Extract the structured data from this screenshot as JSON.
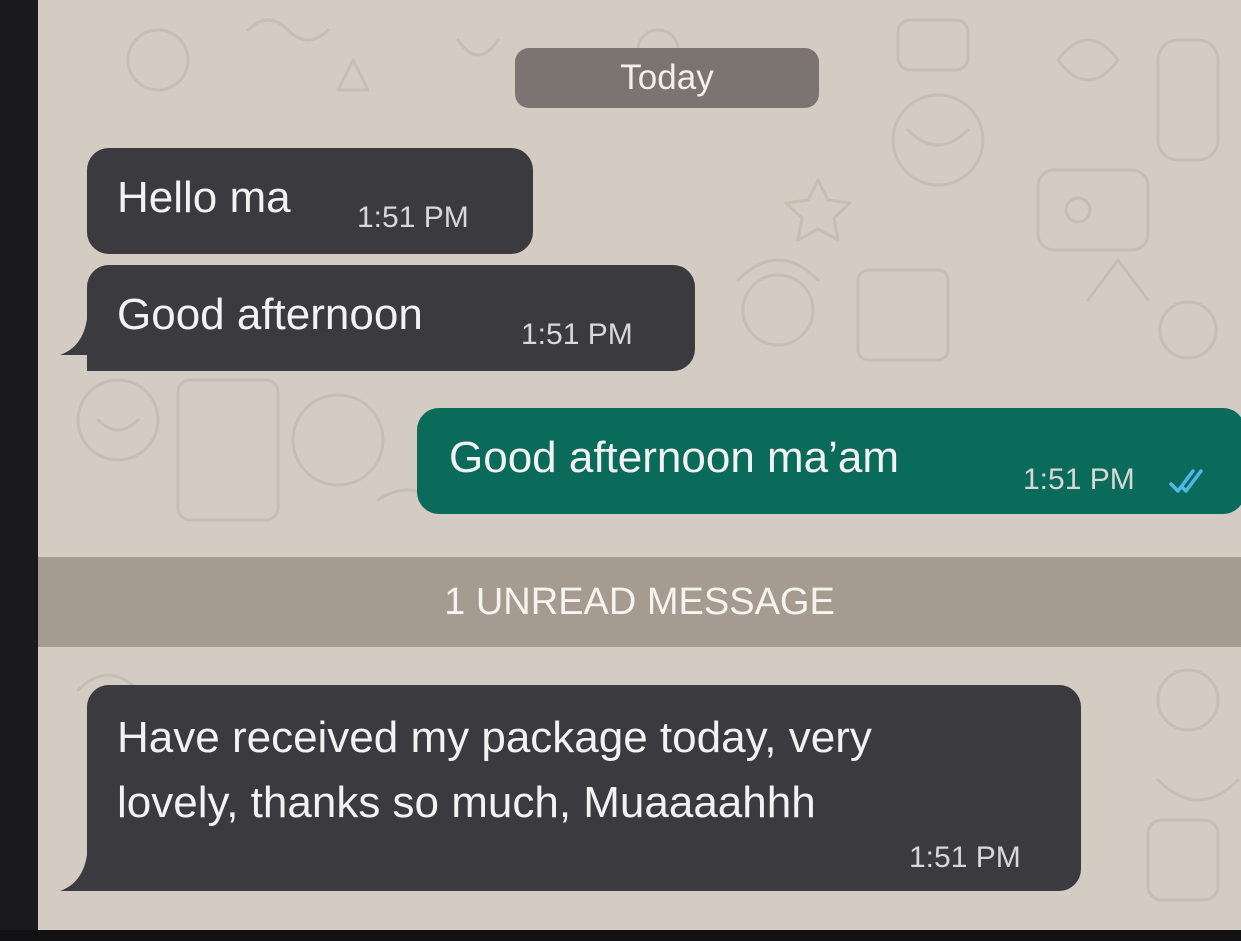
{
  "chat": {
    "date_separator": "Today",
    "unread_banner": "1 UNREAD MESSAGE",
    "messages": [
      {
        "direction": "incoming",
        "text": "Hello ma",
        "time": "1:51 PM"
      },
      {
        "direction": "incoming",
        "text": "Good afternoon",
        "time": "1:51 PM"
      },
      {
        "direction": "outgoing",
        "text": "Good afternoon ma’am",
        "time": "1:51 PM",
        "status": "read",
        "status_icon": "double-check-icon"
      },
      {
        "direction": "incoming",
        "lines": [
          "Have received my package today, very",
          "lovely, thanks so much, Muaaaahhh"
        ],
        "time": "1:51 PM"
      }
    ]
  },
  "colors": {
    "incoming_bubble": "#3b3a3e",
    "outgoing_bubble": "#0b6b5b",
    "wallpaper": "#d4ccc3",
    "unread_banner": "#a69b90",
    "read_ticks": "#4fb6ec"
  }
}
